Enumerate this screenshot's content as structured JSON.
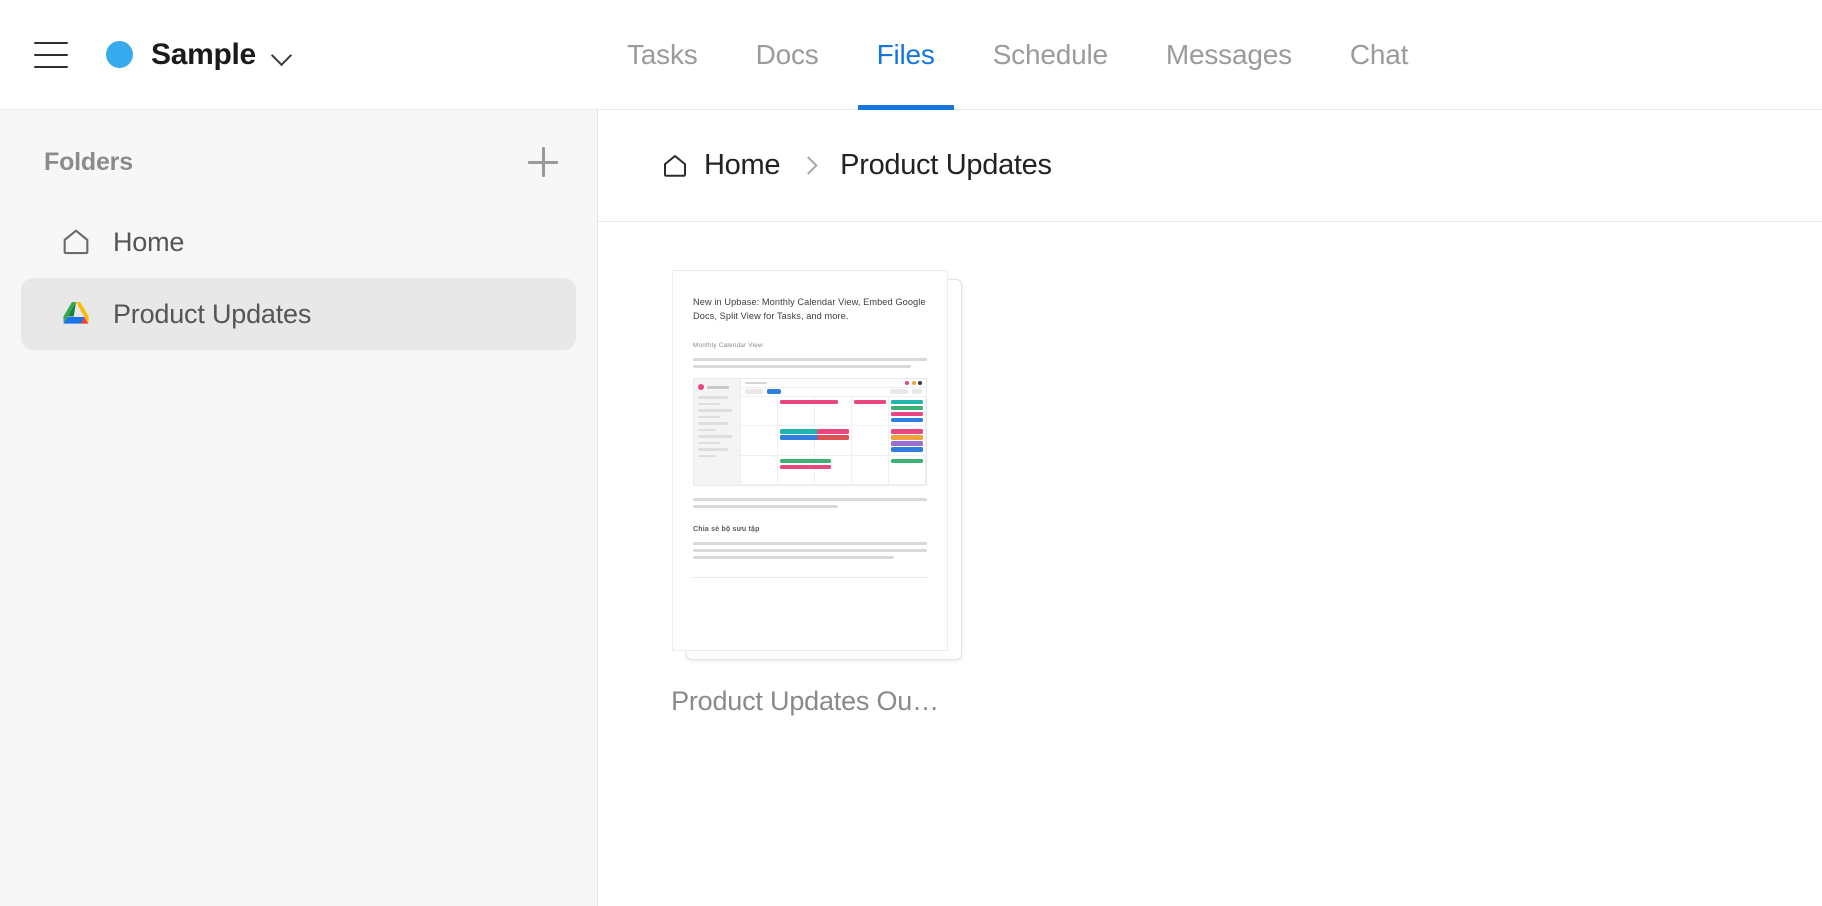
{
  "topbar": {
    "menu_icon": "hamburger-icon",
    "workspace": {
      "dot_color": "#35aaec",
      "name": "Sample",
      "caret_icon": "chevron-down-icon"
    },
    "tabs": [
      {
        "label": "Tasks",
        "active": false
      },
      {
        "label": "Docs",
        "active": false
      },
      {
        "label": "Files",
        "active": true
      },
      {
        "label": "Schedule",
        "active": false
      },
      {
        "label": "Messages",
        "active": false
      },
      {
        "label": "Chat",
        "active": false
      }
    ],
    "active_tab_color": "#1676e0",
    "inactive_tab_color": "#9b9b9b"
  },
  "sidebar": {
    "title": "Folders",
    "add_icon": "plus-icon",
    "items": [
      {
        "label": "Home",
        "icon": "home-icon",
        "active": false
      },
      {
        "label": "Product Updates",
        "icon": "google-drive-icon",
        "active": true
      }
    ],
    "active_bg": "#e8e8e8"
  },
  "breadcrumb": {
    "home_icon": "home-icon",
    "separator_icon": "chevron-right-icon",
    "items": [
      {
        "label": "Home"
      },
      {
        "label": "Product Updates"
      }
    ]
  },
  "files": {
    "items": [
      {
        "name": "Product Updates Ou…",
        "thumbnail": {
          "heading": "New in Upbase: Monthly Calendar View, Embed Google Docs, Split View for Tasks, and more.",
          "section_1": "Monthly Calendar View",
          "section_2": "Chia sẻ bộ sưu tập",
          "event_colors": [
            "#e8467c",
            "#21b6ac",
            "#3bb273",
            "#2f7fe0",
            "#f2a33c",
            "#9b6fd0",
            "#e05252",
            "#16a085"
          ],
          "app_accent": "#e8467c"
        }
      }
    ]
  }
}
